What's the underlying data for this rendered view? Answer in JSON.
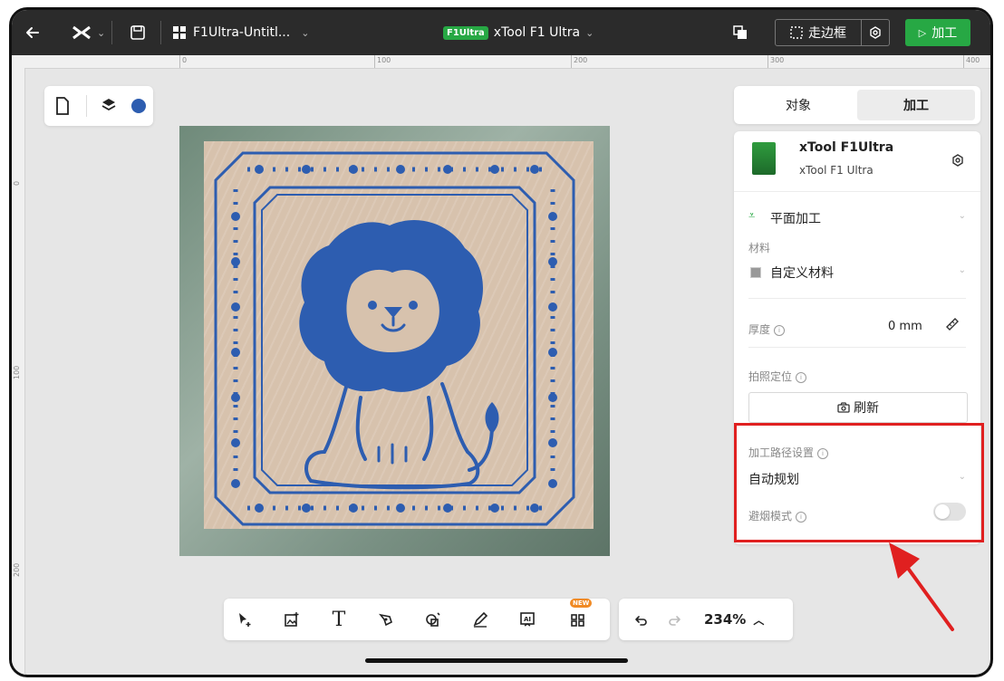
{
  "topbar": {
    "project_name": "F1Ultra-Untitl...",
    "device_badge": "F1Ultra",
    "device_name": "xTool F1 Ultra",
    "frame_button": "走边框",
    "process_button": "加工"
  },
  "ruler": {
    "top_ticks": [
      "0",
      "100",
      "200",
      "300",
      "400"
    ],
    "left_ticks": [
      "0",
      "100",
      "200"
    ]
  },
  "panel": {
    "tabs": {
      "object": "对象",
      "process": "加工"
    },
    "device": {
      "title": "xTool F1Ultra",
      "subtitle": "xTool F1 Ultra"
    },
    "mode": "平面加工",
    "material_label": "材料",
    "material_value": "自定义材料",
    "thickness_label": "厚度",
    "thickness_value": "0 mm",
    "camera_label": "拍照定位",
    "refresh_button": "刷新",
    "path_label": "加工路径设置",
    "path_value": "自动规划",
    "smoke_label": "避烟模式",
    "smoke_enabled": false
  },
  "bottom": {
    "new_badge": "NEW",
    "zoom": "234%"
  },
  "colors": {
    "accent_green": "#27a844",
    "design_blue": "#2d5db0",
    "highlight_red": "#e02020"
  }
}
